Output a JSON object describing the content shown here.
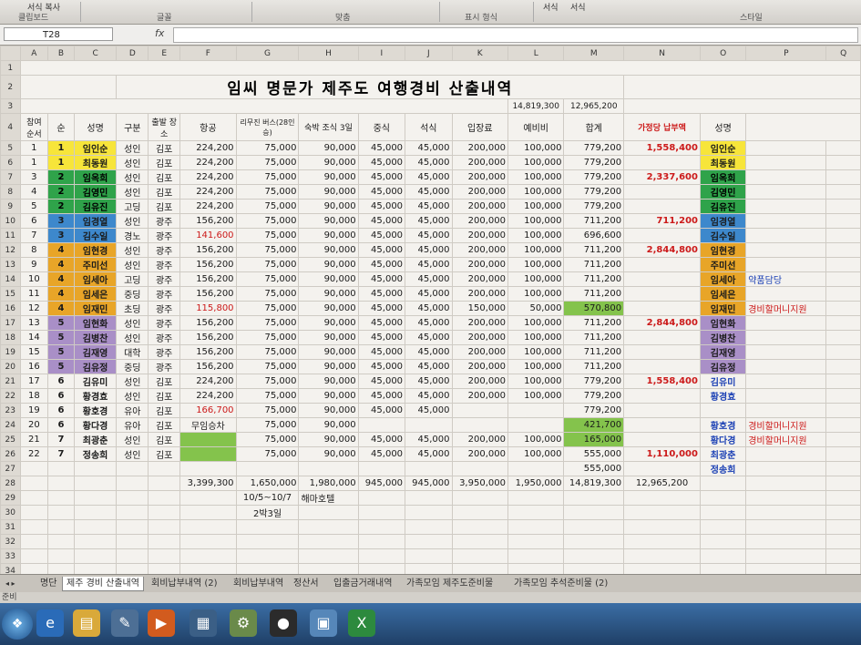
{
  "ribbon": {
    "groups": [
      "클립보드",
      "글꼴",
      "맞춤",
      "표시 형식",
      "스타일"
    ],
    "top_items": [
      "서식 복사",
      "서식",
      "서식"
    ]
  },
  "formula_bar": {
    "cell_ref": "T28",
    "fx_icon": "fx-icon",
    "formula": ""
  },
  "columns": [
    "A",
    "B",
    "C",
    "D",
    "E",
    "F",
    "G",
    "H",
    "I",
    "J",
    "K",
    "L",
    "M",
    "N",
    "O",
    "P",
    "Q"
  ],
  "title": "임씨  명문가  제주도  여행경비  산출내역",
  "totals_top": {
    "M3": "14,819,300",
    "N3": "12,965,200"
  },
  "headers": {
    "A": "참여 순서",
    "B": "순",
    "C": "성명",
    "D": "구분",
    "E": "출발 장소",
    "F": "항공",
    "G": "리무진 버스(28인승)",
    "H": "숙박 조식 3일",
    "I": "중식",
    "J": "석식",
    "K": "입장료",
    "L": "예비비",
    "M": "합계",
    "N": "가정당 납부액",
    "O": "성명"
  },
  "rows": [
    {
      "r": "5",
      "A": "1",
      "B": "1",
      "C": "임인순",
      "D": "성인",
      "E": "김포",
      "F": "224,200",
      "G": "75,000",
      "H": "90,000",
      "I": "45,000",
      "J": "45,000",
      "K": "200,000",
      "L": "100,000",
      "M": "779,200",
      "N": "1,558,400",
      "O": "임인순",
      "P": ""
    },
    {
      "r": "6",
      "A": "1",
      "B": "1",
      "C": "최동원",
      "D": "성인",
      "E": "김포",
      "F": "224,200",
      "G": "75,000",
      "H": "90,000",
      "I": "45,000",
      "J": "45,000",
      "K": "200,000",
      "L": "100,000",
      "M": "779,200",
      "N": "",
      "O": "최동원",
      "P": ""
    },
    {
      "r": "7",
      "A": "3",
      "B": "2",
      "C": "임옥희",
      "D": "성인",
      "E": "김포",
      "F": "224,200",
      "G": "75,000",
      "H": "90,000",
      "I": "45,000",
      "J": "45,000",
      "K": "200,000",
      "L": "100,000",
      "M": "779,200",
      "N": "2,337,600",
      "O": "임옥희",
      "P": ""
    },
    {
      "r": "8",
      "A": "4",
      "B": "2",
      "C": "김영민",
      "D": "성인",
      "E": "김포",
      "F": "224,200",
      "G": "75,000",
      "H": "90,000",
      "I": "45,000",
      "J": "45,000",
      "K": "200,000",
      "L": "100,000",
      "M": "779,200",
      "N": "",
      "O": "김영민",
      "P": ""
    },
    {
      "r": "9",
      "A": "5",
      "B": "2",
      "C": "김유진",
      "D": "고딩",
      "E": "김포",
      "F": "224,200",
      "G": "75,000",
      "H": "90,000",
      "I": "45,000",
      "J": "45,000",
      "K": "200,000",
      "L": "100,000",
      "M": "779,200",
      "N": "",
      "O": "김유진",
      "P": ""
    },
    {
      "r": "10",
      "A": "6",
      "B": "3",
      "C": "임경열",
      "D": "성인",
      "E": "광주",
      "F": "156,200",
      "G": "75,000",
      "H": "90,000",
      "I": "45,000",
      "J": "45,000",
      "K": "200,000",
      "L": "100,000",
      "M": "711,200",
      "N": "711,200",
      "O": "임경열",
      "P": ""
    },
    {
      "r": "11",
      "A": "7",
      "B": "3",
      "C": "김수일",
      "D": "경노",
      "E": "광주",
      "F": "141,600",
      "G": "75,000",
      "H": "90,000",
      "I": "45,000",
      "J": "45,000",
      "K": "200,000",
      "L": "100,000",
      "M": "696,600",
      "N": "",
      "O": "김수일",
      "P": ""
    },
    {
      "r": "12",
      "A": "8",
      "B": "4",
      "C": "임현경",
      "D": "성인",
      "E": "광주",
      "F": "156,200",
      "G": "75,000",
      "H": "90,000",
      "I": "45,000",
      "J": "45,000",
      "K": "200,000",
      "L": "100,000",
      "M": "711,200",
      "N": "2,844,800",
      "O": "임현경",
      "P": ""
    },
    {
      "r": "13",
      "A": "9",
      "B": "4",
      "C": "주미선",
      "D": "성인",
      "E": "광주",
      "F": "156,200",
      "G": "75,000",
      "H": "90,000",
      "I": "45,000",
      "J": "45,000",
      "K": "200,000",
      "L": "100,000",
      "M": "711,200",
      "N": "",
      "O": "주미선",
      "P": ""
    },
    {
      "r": "14",
      "A": "10",
      "B": "4",
      "C": "임세아",
      "D": "고딩",
      "E": "광주",
      "F": "156,200",
      "G": "75,000",
      "H": "90,000",
      "I": "45,000",
      "J": "45,000",
      "K": "200,000",
      "L": "100,000",
      "M": "711,200",
      "N": "",
      "O": "임세아",
      "P": "약품담당"
    },
    {
      "r": "15",
      "A": "11",
      "B": "4",
      "C": "임세은",
      "D": "중딩",
      "E": "광주",
      "F": "156,200",
      "G": "75,000",
      "H": "90,000",
      "I": "45,000",
      "J": "45,000",
      "K": "200,000",
      "L": "100,000",
      "M": "711,200",
      "N": "",
      "O": "임세은",
      "P": ""
    },
    {
      "r": "16",
      "A": "12",
      "B": "4",
      "C": "임재민",
      "D": "초딩",
      "E": "광주",
      "F": "115,800",
      "G": "75,000",
      "H": "90,000",
      "I": "45,000",
      "J": "45,000",
      "K": "150,000",
      "L": "50,000",
      "M": "570,800",
      "N": "",
      "O": "임재민",
      "P": "경비할머니지원"
    },
    {
      "r": "17",
      "A": "13",
      "B": "5",
      "C": "임현화",
      "D": "성인",
      "E": "광주",
      "F": "156,200",
      "G": "75,000",
      "H": "90,000",
      "I": "45,000",
      "J": "45,000",
      "K": "200,000",
      "L": "100,000",
      "M": "711,200",
      "N": "2,844,800",
      "O": "임현화",
      "P": ""
    },
    {
      "r": "18",
      "A": "14",
      "B": "5",
      "C": "김병찬",
      "D": "성인",
      "E": "광주",
      "F": "156,200",
      "G": "75,000",
      "H": "90,000",
      "I": "45,000",
      "J": "45,000",
      "K": "200,000",
      "L": "100,000",
      "M": "711,200",
      "N": "",
      "O": "김병찬",
      "P": ""
    },
    {
      "r": "19",
      "A": "15",
      "B": "5",
      "C": "김재영",
      "D": "대학",
      "E": "광주",
      "F": "156,200",
      "G": "75,000",
      "H": "90,000",
      "I": "45,000",
      "J": "45,000",
      "K": "200,000",
      "L": "100,000",
      "M": "711,200",
      "N": "",
      "O": "김재영",
      "P": ""
    },
    {
      "r": "20",
      "A": "16",
      "B": "5",
      "C": "김유정",
      "D": "중딩",
      "E": "광주",
      "F": "156,200",
      "G": "75,000",
      "H": "90,000",
      "I": "45,000",
      "J": "45,000",
      "K": "200,000",
      "L": "100,000",
      "M": "711,200",
      "N": "",
      "O": "김유정",
      "P": ""
    },
    {
      "r": "21",
      "A": "17",
      "B": "6",
      "C": "김유미",
      "D": "성인",
      "E": "김포",
      "F": "224,200",
      "G": "75,000",
      "H": "90,000",
      "I": "45,000",
      "J": "45,000",
      "K": "200,000",
      "L": "100,000",
      "M": "779,200",
      "N": "1,558,400",
      "O": "김유미",
      "P": ""
    },
    {
      "r": "22",
      "A": "18",
      "B": "6",
      "C": "황경효",
      "D": "성인",
      "E": "김포",
      "F": "224,200",
      "G": "75,000",
      "H": "90,000",
      "I": "45,000",
      "J": "45,000",
      "K": "200,000",
      "L": "100,000",
      "M": "779,200",
      "N": "",
      "O": "황경효",
      "P": ""
    },
    {
      "r": "23",
      "A": "19",
      "B": "6",
      "C": "황호경",
      "D": "유아",
      "E": "김포",
      "F": "166,700",
      "G": "75,000",
      "H": "90,000",
      "I": "45,000",
      "J": "45,000",
      "K": "",
      "L": "",
      "M": "779,200",
      "N": "",
      "O": "",
      "P": ""
    },
    {
      "r": "24",
      "A": "20",
      "B": "6",
      "C": "황다경",
      "D": "유아",
      "E": "김포",
      "F": "무임승차",
      "G": "75,000",
      "H": "90,000",
      "I": "",
      "J": "",
      "K": "",
      "L": "",
      "M": "421,700",
      "N": "",
      "O": "황호경",
      "P": "경비할머니지원"
    },
    {
      "r": "25",
      "A": "21",
      "B": "7",
      "C": "최광춘",
      "D": "성인",
      "E": "김포",
      "F": "",
      "G": "75,000",
      "H": "90,000",
      "I": "45,000",
      "J": "45,000",
      "K": "200,000",
      "L": "100,000",
      "M": "165,000",
      "N": "",
      "O": "황다경",
      "P": "경비할머니지원"
    },
    {
      "r": "26",
      "A": "22",
      "B": "7",
      "C": "정송희",
      "D": "성인",
      "E": "김포",
      "F": "",
      "G": "75,000",
      "H": "90,000",
      "I": "45,000",
      "J": "45,000",
      "K": "200,000",
      "L": "100,000",
      "M": "555,000",
      "N": "1,110,000",
      "O": "최광춘",
      "P": ""
    },
    {
      "r": "27",
      "A": "",
      "B": "",
      "C": "",
      "D": "",
      "E": "",
      "F": "",
      "G": "",
      "H": "",
      "I": "",
      "J": "",
      "K": "",
      "L": "",
      "M": "555,000",
      "N": "",
      "O": "정송희",
      "P": ""
    },
    {
      "r": "28",
      "A": "",
      "B": "",
      "C": "",
      "D": "",
      "E": "",
      "F": "3,399,300",
      "G": "1,650,000",
      "H": "1,980,000",
      "I": "945,000",
      "J": "945,000",
      "K": "3,950,000",
      "L": "1,950,000",
      "M": "14,819,300",
      "N": "12,965,200",
      "O": "",
      "P": ""
    },
    {
      "r": "29",
      "A": "",
      "B": "",
      "C": "",
      "D": "",
      "E": "",
      "F": "",
      "G": "10/5~10/7",
      "H": "해마호텔",
      "I": "",
      "J": "",
      "K": "",
      "L": "",
      "M": "",
      "N": "",
      "O": "",
      "P": ""
    },
    {
      "r": "30",
      "A": "",
      "B": "",
      "C": "",
      "D": "",
      "E": "",
      "F": "",
      "G": "2박3일",
      "H": "",
      "I": "",
      "J": "",
      "K": "",
      "L": "",
      "M": "",
      "N": "",
      "O": "",
      "P": ""
    }
  ],
  "empty_rows": [
    "31",
    "32",
    "33",
    "34",
    "35"
  ],
  "sheet_tabs": [
    "명단",
    "제주 경비 산출내역",
    "회비납부내역 (2)",
    "회비납부내역",
    "정산서",
    "입출금거래내역",
    "가족모임 제주도준비물",
    "가족모임 추석준비물 (2)"
  ],
  "status": "준비",
  "taskbar": {
    "start": "start-orb",
    "apps": [
      "ie-icon",
      "folder-icon",
      "paint-icon",
      "media-icon",
      "excel-icon",
      "tools-icon",
      "penguin-icon",
      "network-icon",
      "excel-active-icon"
    ]
  }
}
